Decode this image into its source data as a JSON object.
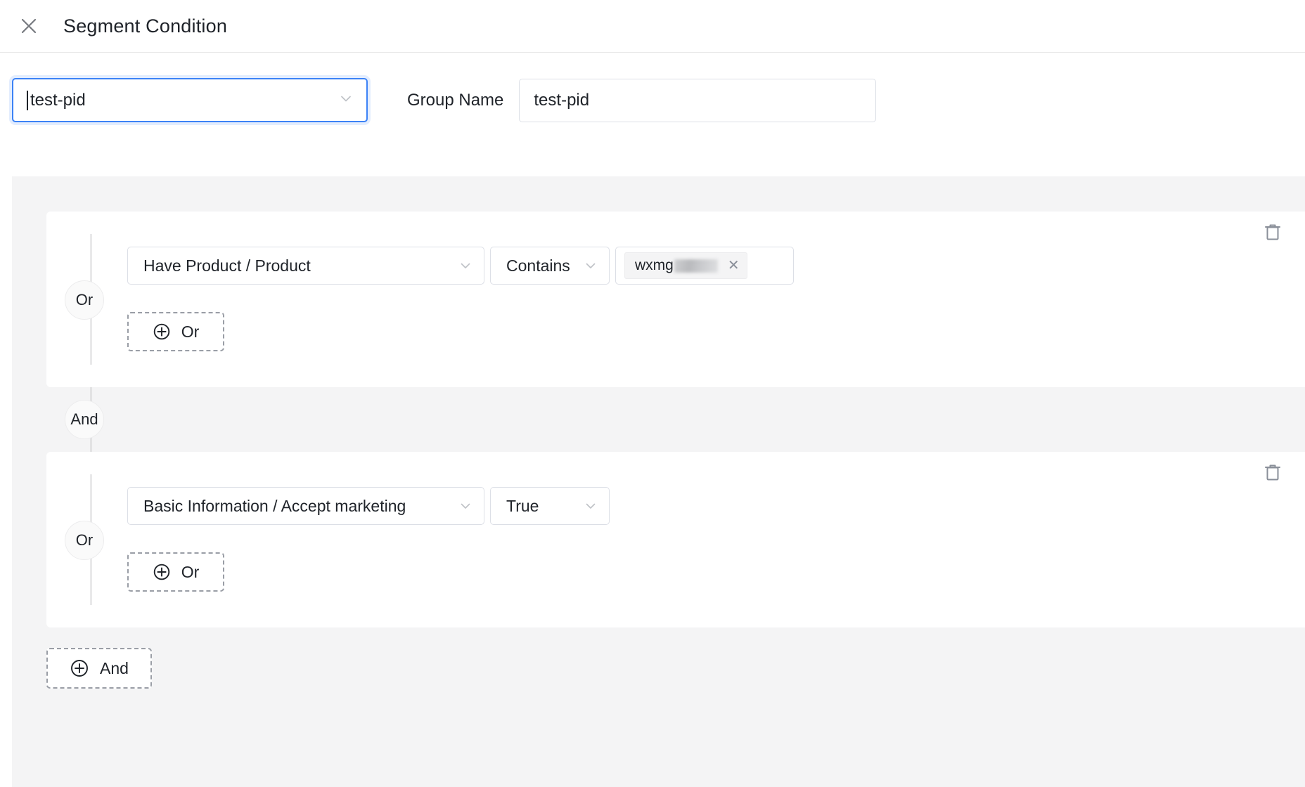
{
  "header": {
    "close_icon": "close-icon",
    "title": "Segment Condition"
  },
  "top_form": {
    "segment_select": {
      "value": "test-pid",
      "caret_icon": "chevron-down-icon"
    },
    "group_name_label": "Group Name",
    "group_name_input": {
      "value": "test-pid",
      "placeholder": "Group Name"
    }
  },
  "builder": {
    "and_separator_label": "And",
    "add_and_label": "And",
    "add_and_icon": "plus-circle-icon",
    "groups": [
      {
        "delete_icon": "trash-icon",
        "or_badge_label": "Or",
        "condition": {
          "field": {
            "value": "Have Product / Product",
            "caret_icon": "chevron-down-icon"
          },
          "operator": {
            "value": "Contains",
            "caret_icon": "chevron-down-icon"
          },
          "tag_value": {
            "text": "wxmg",
            "redacted": true,
            "remove_icon": "close-icon"
          }
        },
        "add_or_label": "Or",
        "add_or_icon": "plus-circle-icon"
      },
      {
        "delete_icon": "trash-icon",
        "or_badge_label": "Or",
        "condition": {
          "field": {
            "value": "Basic Information / Accept marketing",
            "caret_icon": "chevron-down-icon"
          },
          "operator": {
            "value": "True",
            "caret_icon": "chevron-down-icon"
          }
        },
        "add_or_label": "Or",
        "add_or_icon": "plus-circle-icon"
      }
    ]
  },
  "colors": {
    "focus_border": "#3c82f6",
    "panel_bg": "#f4f4f5",
    "card_bg": "#ffffff",
    "border": "#dcdfe6",
    "text": "#1f2329"
  }
}
